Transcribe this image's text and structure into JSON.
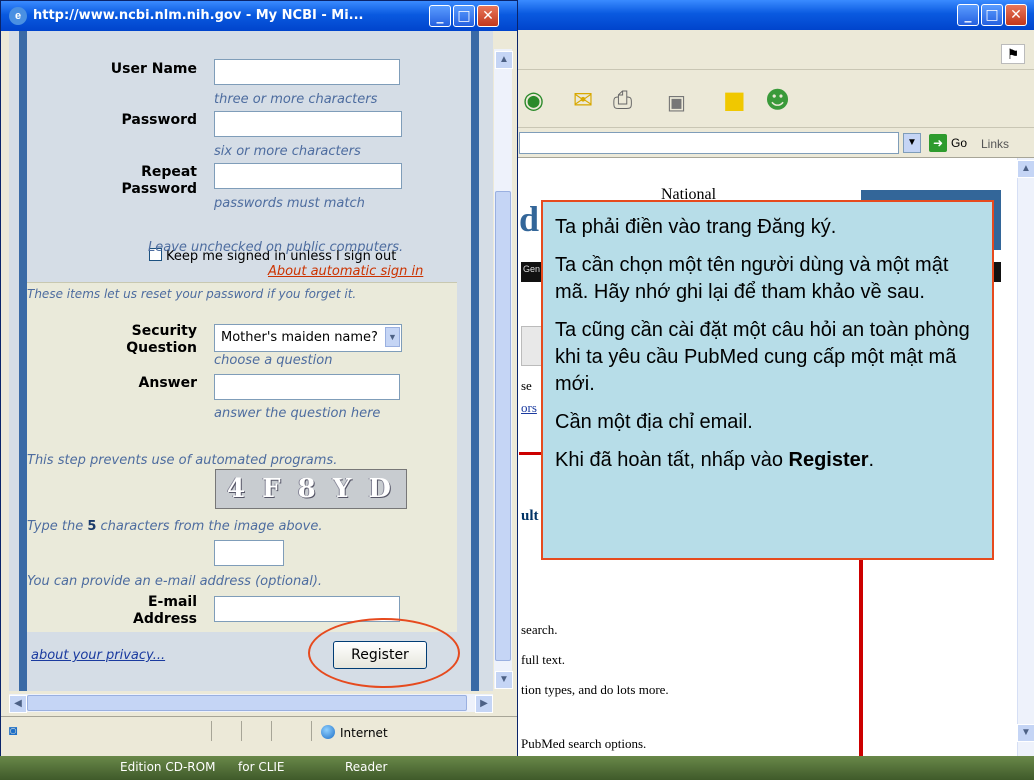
{
  "popup": {
    "title": "http://www.ncbi.nlm.nih.gov - My NCBI - Mi...",
    "form": {
      "username_label": "User Name",
      "username_hint": "three or more characters",
      "password_label": "Password",
      "password_hint": "six or more characters",
      "repeat_label_1": "Repeat",
      "repeat_label_2": "Password",
      "repeat_hint": "passwords must match",
      "keep_signed_in": "Keep me signed in unless I sign out",
      "keep_hint": "Leave unchecked on public computers.",
      "about_auto": "About automatic sign in",
      "reset_note": "These items let us reset your password if you forget it.",
      "security_label_1": "Security",
      "security_label_2": "Question",
      "security_selected": "Mother's maiden name?",
      "security_hint": "choose a question",
      "answer_label": "Answer",
      "answer_hint": "answer the question here",
      "automation_note": "This step prevents use of automated programs.",
      "captcha_text": "4 F 8 Y D",
      "type_prefix": "Type the ",
      "type_count": "5",
      "type_suffix": " characters from the image above.",
      "email_note": "You can provide an e-mail address (optional).",
      "email_label_1": "E-mail",
      "email_label_2": "Address",
      "privacy_link": "about your privacy...",
      "register_button": "Register"
    },
    "status": {
      "zone": "Internet"
    }
  },
  "background_browser": {
    "address_go": "Go",
    "links": "Links",
    "national": "National",
    "blackbar_fragment": "Gen",
    "fragments": [
      "se",
      "ors",
      "ult",
      "search.",
      "full text.",
      "tion types, and do lots more.",
      "PubMed search options."
    ]
  },
  "callout": {
    "line1": "Ta phải điền vào trang Đăng ký.",
    "line2": "Ta cần chọn một tên người dùng và một mật mã. Hãy nhớ ghi lại để tham khảo về sau.",
    "line3": "Ta cũng cần cài đặt một câu hỏi an toàn phòng khi ta yêu cầu PubMed cung cấp một mật mã mới.",
    "line4": "Cần một địa chỉ email.",
    "line5_prefix": "Khi đã hoàn tất, nhấp vào ",
    "line5_bold": "Register",
    "line5_suffix": "."
  },
  "desktop": {
    "labels": [
      "Edition CD-ROM",
      "for CLIE",
      "Reader"
    ]
  },
  "colors": {
    "accent_ring": "#e64a1e",
    "callout_bg": "#b7dde8",
    "xp_title": "#0a5ae0"
  }
}
